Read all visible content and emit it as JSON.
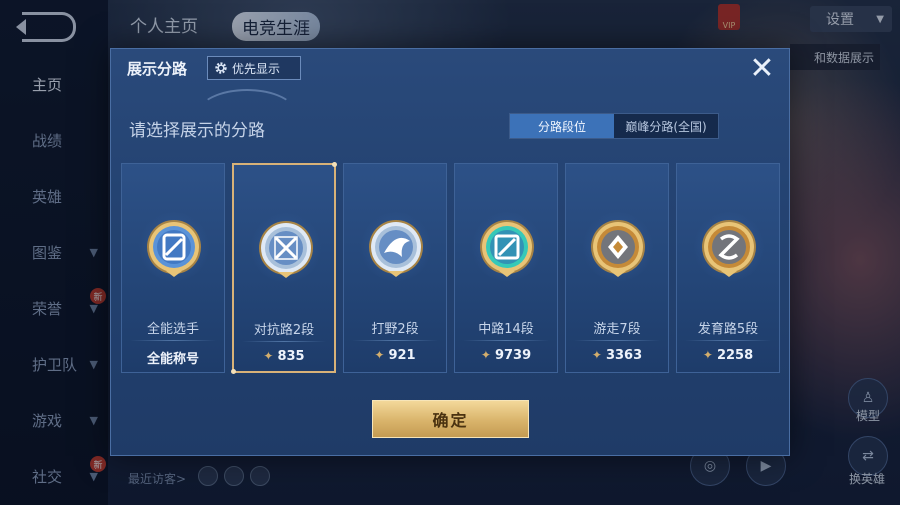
{
  "background": {
    "nav": [
      {
        "label": "主页",
        "active": true,
        "chevron": false,
        "badge": ""
      },
      {
        "label": "战绩",
        "active": false,
        "chevron": false,
        "badge": ""
      },
      {
        "label": "英雄",
        "active": false,
        "chevron": false,
        "badge": ""
      },
      {
        "label": "图鉴",
        "active": false,
        "chevron": true,
        "badge": ""
      },
      {
        "label": "荣誉",
        "active": false,
        "chevron": true,
        "badge": "新"
      },
      {
        "label": "护卫队",
        "active": false,
        "chevron": true,
        "badge": ""
      },
      {
        "label": "游戏",
        "active": false,
        "chevron": true,
        "badge": ""
      },
      {
        "label": "社交",
        "active": false,
        "chevron": true,
        "badge": "新"
      }
    ],
    "tabs": {
      "profile": "个人主页",
      "esports": "电竞生涯"
    },
    "settings_label": "设置",
    "vip_label": "VIP",
    "right_tag": "和数据展示",
    "recent_visitors": "最近访客>",
    "side_buttons": {
      "model": "模型",
      "switch_hero": "换英雄"
    }
  },
  "modal": {
    "title": "展示分路",
    "priority_button": "优先显示",
    "close_icon": "✕",
    "subtitle": "请选择展示的分路",
    "segments": [
      "分路段位",
      "巅峰分路(全国)"
    ],
    "active_segment": 0,
    "cards": [
      {
        "role": "全能选手",
        "score": "全能称号",
        "show_points_icon": false,
        "badge": "allround",
        "selected": false
      },
      {
        "role": "对抗路2段",
        "score": "835",
        "show_points_icon": true,
        "badge": "clash",
        "selected": true
      },
      {
        "role": "打野2段",
        "score": "921",
        "show_points_icon": true,
        "badge": "jungle",
        "selected": false
      },
      {
        "role": "中路14段",
        "score": "9739",
        "show_points_icon": true,
        "badge": "mid",
        "selected": false
      },
      {
        "role": "游走7段",
        "score": "3363",
        "show_points_icon": true,
        "badge": "roam",
        "selected": false
      },
      {
        "role": "发育路5段",
        "score": "2258",
        "show_points_icon": true,
        "badge": "farm",
        "selected": false
      }
    ],
    "confirm_label": "确定"
  },
  "colors": {
    "accent_gold": "#d8b278",
    "panel_blue": "#244372",
    "segment_active": "#3c72b8"
  }
}
